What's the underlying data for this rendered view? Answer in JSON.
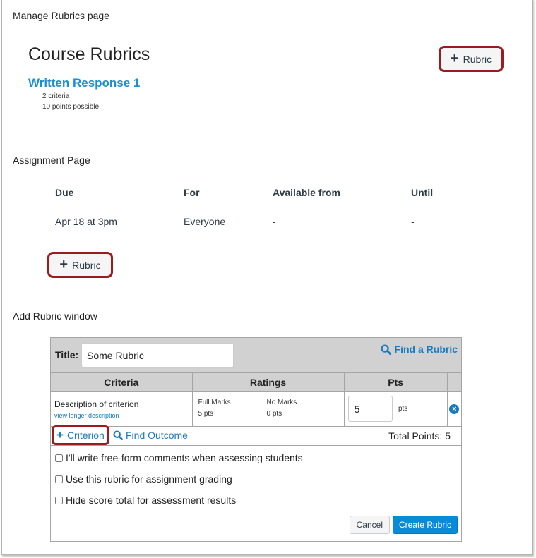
{
  "sections": {
    "manage_rubrics_label": "Manage Rubrics page",
    "assignment_page_label": "Assignment Page",
    "add_rubric_window_label": "Add Rubric window"
  },
  "course_rubrics": {
    "title": "Course Rubrics",
    "add_button": {
      "icon": "plus-icon",
      "label": "Rubric"
    },
    "rubric": {
      "name": "Written Response 1",
      "criteria_count": "2 criteria",
      "points_possible": "10 points possible"
    }
  },
  "assignment": {
    "columns": [
      "Due",
      "For",
      "Available from",
      "Until"
    ],
    "rows": [
      [
        "Apr 18 at 3pm",
        "Everyone",
        "-",
        "-"
      ]
    ],
    "add_button": {
      "icon": "plus-icon",
      "label": "Rubric"
    }
  },
  "rubric_window": {
    "title_label": "Title:",
    "title_value": "Some Rubric",
    "find_rubric": {
      "icon": "search-icon",
      "label": "Find a Rubric"
    },
    "columns": [
      "Criteria",
      "Ratings",
      "Pts"
    ],
    "criterion": {
      "description": "Description of criterion",
      "longer_link": "view longer description",
      "ratings": [
        {
          "label": "Full Marks",
          "points": "5 pts"
        },
        {
          "label": "No Marks",
          "points": "0 pts"
        }
      ],
      "points_value": "5",
      "points_unit": "pts",
      "delete_icon": "close-circle-icon"
    },
    "add_criterion": {
      "icon": "plus-icon",
      "label": "Criterion"
    },
    "find_outcome": {
      "icon": "search-icon",
      "label": "Find Outcome"
    },
    "total_points": "Total Points: 5",
    "options": [
      {
        "label": "I'll write free-form comments when assessing students",
        "checked": false
      },
      {
        "label": "Use this rubric for assignment grading",
        "checked": false
      },
      {
        "label": "Hide score total for assessment results",
        "checked": false
      }
    ],
    "cancel_label": "Cancel",
    "create_label": "Create Rubric"
  },
  "colors": {
    "link_blue": "#1a8fd6",
    "primary_button": "#0a8bd8",
    "highlight_outline": "#9b1b1e",
    "header_gray": "#d1d1d1"
  }
}
